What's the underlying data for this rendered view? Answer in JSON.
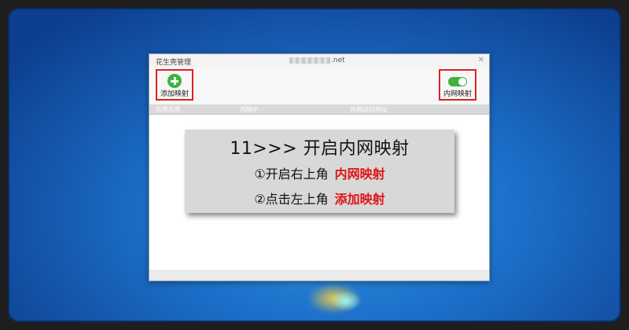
{
  "window": {
    "title": "花生壳管理",
    "account_suffix": ".net",
    "close_glyph": "✕"
  },
  "toolbar": {
    "add_mapping_label": "添加映射",
    "intranet_mapping_label": "内网映射",
    "intranet_mapping_enabled": true,
    "add_icon": "plus-circle-icon",
    "toggle_icon": "toggle-switch-icon"
  },
  "table": {
    "columns": [
      "应用名称",
      "内网IP",
      "外网访问地址"
    ]
  },
  "instruction": {
    "title": "11>>>  开启内网映射",
    "step1_prefix": "①开启右上角",
    "step1_highlight": "内网映射",
    "step2_prefix": "②点击左上角",
    "step2_highlight": "添加映射"
  },
  "colors": {
    "highlight_red": "#e01414",
    "green": "#3eb33e",
    "border_red": "#e02020"
  }
}
